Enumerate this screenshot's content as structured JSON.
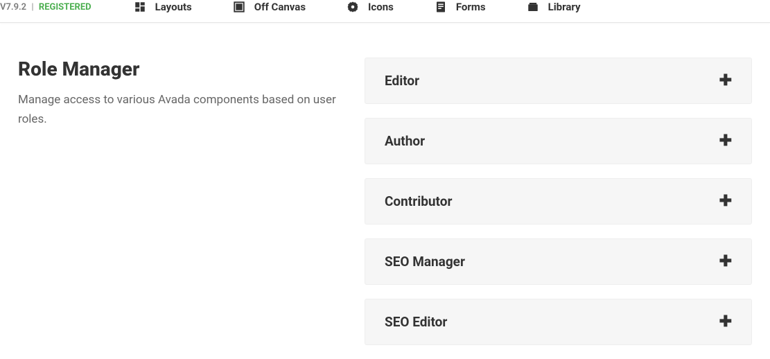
{
  "topbar": {
    "version": "V7.9.2",
    "status": "REGISTERED",
    "nav": [
      {
        "label": "Layouts"
      },
      {
        "label": "Off Canvas"
      },
      {
        "label": "Icons"
      },
      {
        "label": "Forms"
      },
      {
        "label": "Library"
      }
    ]
  },
  "page": {
    "title": "Role Manager",
    "description": "Manage access to various Avada components based on user roles."
  },
  "roles": [
    {
      "name": "Editor"
    },
    {
      "name": "Author"
    },
    {
      "name": "Contributor"
    },
    {
      "name": "SEO Manager"
    },
    {
      "name": "SEO Editor"
    }
  ]
}
